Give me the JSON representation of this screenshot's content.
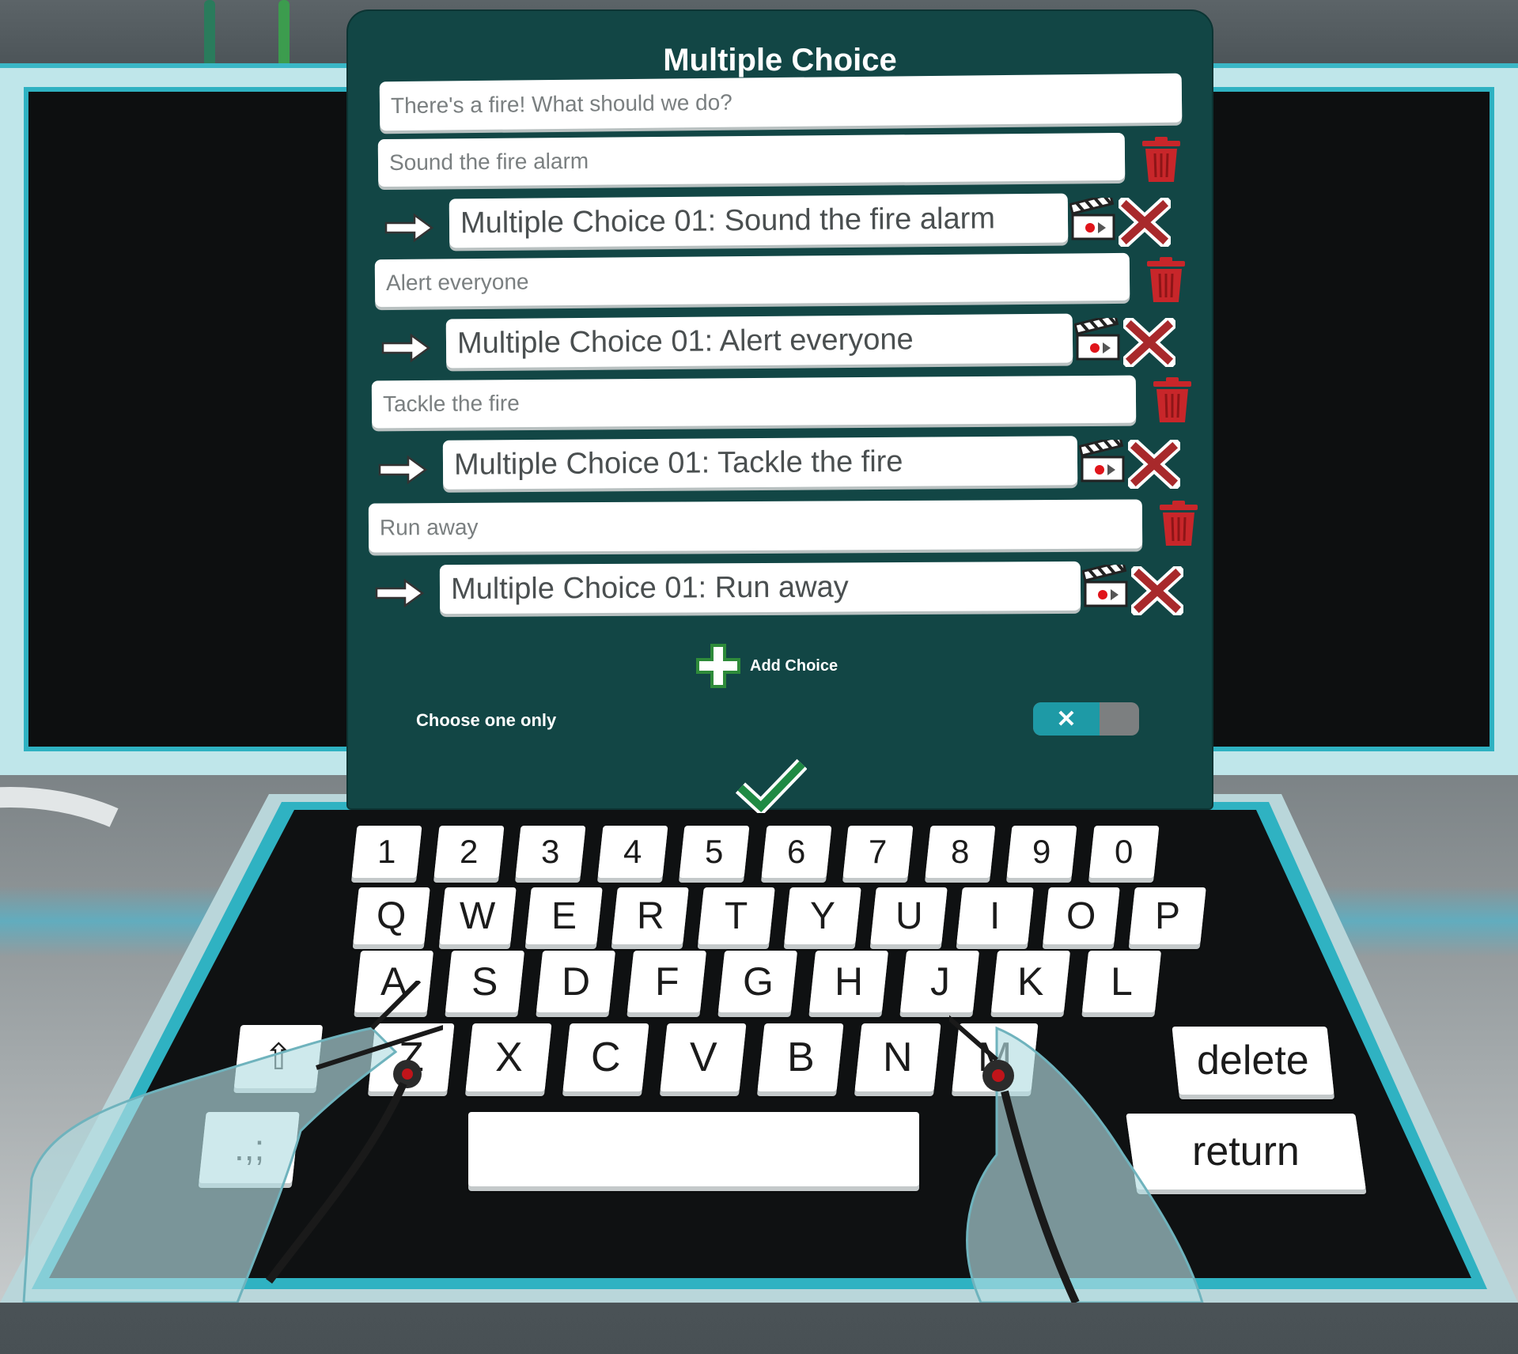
{
  "panel": {
    "title": "Multiple Choice",
    "question": "There's a fire! What should we do?",
    "choices": [
      {
        "text": "Sound the fire alarm",
        "link": "Multiple Choice 01: Sound the fire alarm"
      },
      {
        "text": "Alert everyone",
        "link": "Multiple Choice 01: Alert everyone"
      },
      {
        "text": "Tackle the fire",
        "link": "Multiple Choice 01: Tackle the fire"
      },
      {
        "text": "Run away",
        "link": "Multiple Choice 01: Run away"
      }
    ],
    "add_choice_label": "Add Choice",
    "choose_one_label": "Choose one only",
    "choose_one_toggle": {
      "on": false,
      "symbol": "✕"
    },
    "icons": {
      "delete": "trash-icon",
      "link": "arrow-right-icon",
      "scene": "clapperboard-icon",
      "remove_link": "close-icon",
      "add": "plus-icon",
      "confirm": "checkmark-icon"
    }
  },
  "keyboard": {
    "row_digits": [
      "1",
      "2",
      "3",
      "4",
      "5",
      "6",
      "7",
      "8",
      "9",
      "0"
    ],
    "row_top": [
      "Q",
      "W",
      "E",
      "R",
      "T",
      "Y",
      "U",
      "I",
      "O",
      "P"
    ],
    "row_home": [
      "A",
      "S",
      "D",
      "F",
      "G",
      "H",
      "J",
      "K",
      "L"
    ],
    "row_bottom": [
      "Z",
      "X",
      "C",
      "V",
      "B",
      "N",
      "M"
    ],
    "shift": "⇧",
    "punct": ".,;",
    "delete": "delete",
    "return": "return"
  },
  "colors": {
    "panel_bg": "#124645",
    "accent": "#1e9aa6",
    "delete_red": "#c8262a",
    "add_green": "#2e8b3a"
  }
}
